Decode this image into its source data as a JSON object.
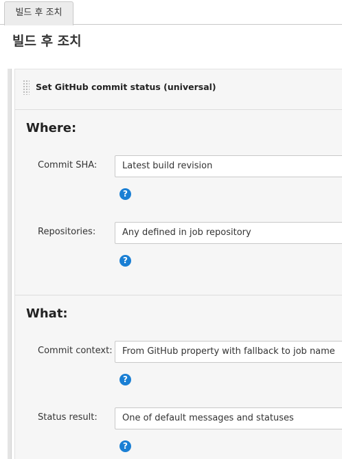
{
  "tabs": [
    {
      "label": "빌드 후 조치",
      "active": true
    }
  ],
  "page": {
    "title": "빌드 후 조치"
  },
  "step": {
    "title": "Set GitHub commit status (universal)",
    "sections": [
      {
        "title": "Where:",
        "fields": [
          {
            "label": "Commit SHA:",
            "value": "Latest build revision",
            "help_icon": "question-circle-icon"
          },
          {
            "label": "Repositories:",
            "value": "Any defined in job repository",
            "help_icon": "question-circle-icon"
          }
        ]
      },
      {
        "title": "What:",
        "fields": [
          {
            "label": "Commit context:",
            "value": "From GitHub property with fallback to job name",
            "help_icon": "question-circle-icon"
          },
          {
            "label": "Status result:",
            "value": "One of default messages and statuses",
            "help_icon": "question-circle-icon"
          }
        ]
      }
    ]
  },
  "help_glyph": "?",
  "colors": {
    "help_icon": "#1a7fd4",
    "panel_background": "#f6f6f6",
    "border": "#c8c8c8"
  }
}
